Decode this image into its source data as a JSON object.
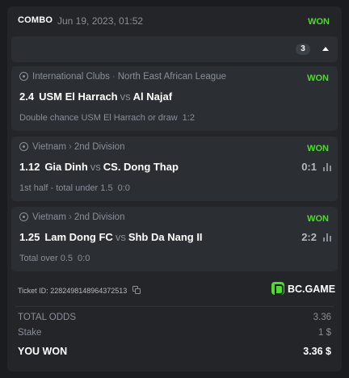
{
  "header": {
    "type_label": "COMBO",
    "datetime": "Jun 19, 2023, 01:52",
    "status": "WON"
  },
  "counter": {
    "count": "3",
    "toggle_icon": "chevron-up-icon"
  },
  "matches": [
    {
      "sport_icon": "soccer-ball-icon",
      "category": "International Clubs",
      "league": "North East African League",
      "status": "WON",
      "odds": "2.4",
      "home": "USM El Harrach",
      "vs": "vs",
      "away": "Al Najaf",
      "score": "",
      "bet": "Double chance USM El Harrach or draw",
      "bet_coef": "1:2"
    },
    {
      "sport_icon": "soccer-ball-icon",
      "category": "Vietnam",
      "league": "2nd Division",
      "status": "WON",
      "odds": "1.12",
      "home": "Gia Dinh",
      "vs": "vs",
      "away": "CS. Dong Thap",
      "score": "0:1",
      "bet": "1st half - total under 1.5",
      "bet_coef": "0:0"
    },
    {
      "sport_icon": "soccer-ball-icon",
      "category": "Vietnam",
      "league": "2nd Division",
      "status": "WON",
      "odds": "1.25",
      "home": "Lam Dong FC",
      "vs": "vs",
      "away": "Shb Da Nang II",
      "score": "2:2",
      "bet": "Total over 0.5",
      "bet_coef": "0:0"
    }
  ],
  "ticket": {
    "label": "Ticket ID:",
    "id": "2282498148964372513"
  },
  "brand": {
    "name": "BC.GAME"
  },
  "summary": {
    "total_odds_label": "TOTAL ODDS",
    "total_odds_value": "3.36",
    "stake_label": "Stake",
    "stake_value": "1 $",
    "result_label": "YOU WON",
    "result_value": "3.36 $"
  },
  "colors": {
    "background": "#1a1c1f",
    "card": "#232529",
    "panel": "#2b2e33",
    "won": "#4ddc2c",
    "muted_text": "#8a8f98"
  }
}
